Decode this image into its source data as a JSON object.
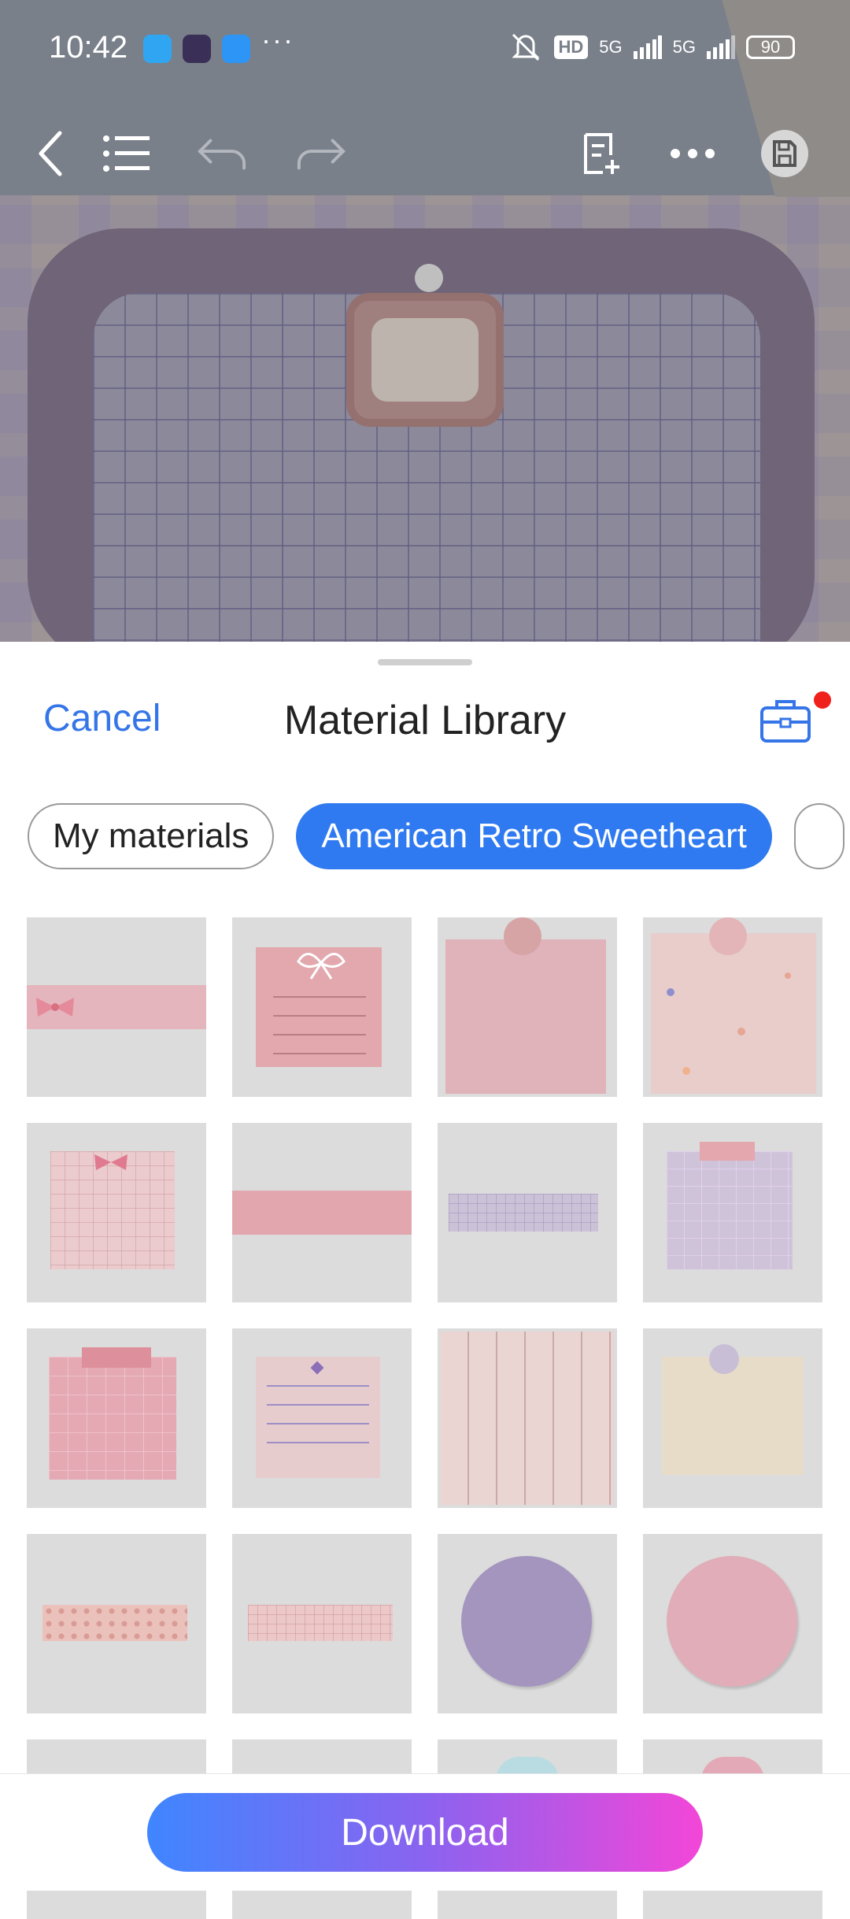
{
  "status_bar": {
    "time": "10:42",
    "more": "···",
    "network": "5G",
    "hd_label": "HD",
    "battery": "90"
  },
  "sheet": {
    "cancel_label": "Cancel",
    "title": "Material Library",
    "tabs": [
      {
        "label": "My materials",
        "active": false
      },
      {
        "label": "American Retro Sweetheart",
        "active": true
      }
    ],
    "download_label": "Download"
  },
  "colors": {
    "accent": "#2f7af0",
    "download_gradient": [
      "#3f86ff",
      "#f346d8"
    ],
    "badge": "#f0201b"
  },
  "materials": [
    {
      "name": "pink-bow-ribbon-tape"
    },
    {
      "name": "pink-bow-lined-note"
    },
    {
      "name": "pink-pinned-note"
    },
    {
      "name": "floral-pinned-note"
    },
    {
      "name": "pink-bow-grid-note"
    },
    {
      "name": "pink-washi-tape"
    },
    {
      "name": "lavender-grid-tape"
    },
    {
      "name": "lavender-grid-note-taped"
    },
    {
      "name": "pink-grid-note-taped"
    },
    {
      "name": "lavender-lined-floral-note"
    },
    {
      "name": "pink-bow-striped-paper"
    },
    {
      "name": "cream-pinned-note"
    },
    {
      "name": "pink-heart-tape"
    },
    {
      "name": "pink-grid-tape"
    },
    {
      "name": "purple-circle"
    },
    {
      "name": "pink-circle"
    }
  ]
}
